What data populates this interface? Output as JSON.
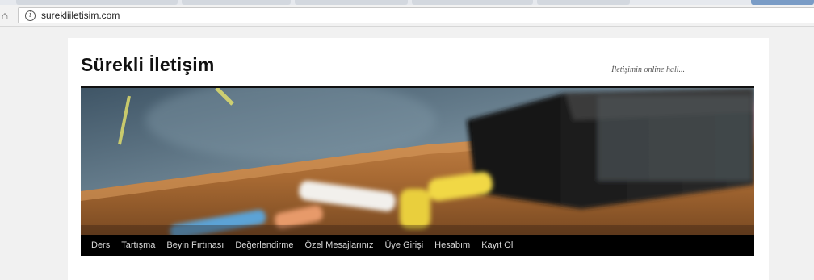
{
  "browser": {
    "url": "surekliiletisim.com",
    "icons": {
      "home": "home-icon",
      "info": "info-icon"
    }
  },
  "site": {
    "title": "Sürekli İletişim",
    "description": "İletişimin online hali..."
  },
  "banner": {
    "alt": ""
  },
  "nav": {
    "items": [
      {
        "label": "Ders"
      },
      {
        "label": "Tartışma"
      },
      {
        "label": "Beyin Fırtınası"
      },
      {
        "label": "Değerlendirme"
      },
      {
        "label": "Özel Mesajlarınız"
      },
      {
        "label": "Üye Girişi"
      },
      {
        "label": "Hesabım"
      },
      {
        "label": "Kayıt Ol"
      }
    ]
  }
}
